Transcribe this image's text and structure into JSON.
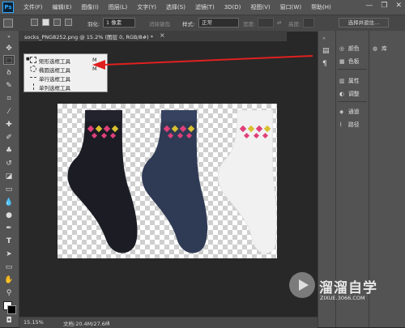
{
  "app": {
    "logo": "Ps"
  },
  "menubar": {
    "items": [
      "文件(F)",
      "编辑(E)",
      "图像(I)",
      "图层(L)",
      "文字(Y)",
      "选择(S)",
      "滤镜(T)",
      "3D(D)",
      "视图(V)",
      "窗口(W)",
      "帮助(H)"
    ],
    "window_controls": [
      "—",
      "❐",
      "✕"
    ]
  },
  "options_bar": {
    "feather_label": "羽化:",
    "feather_value": "1 像素",
    "antialias_label": "消除锯齿",
    "style_label": "样式:",
    "style_value": "正常",
    "width_label": "宽度:",
    "height_label": "高度:",
    "select_mask_label": "选择并遮住..."
  },
  "document_tab": {
    "title": "socks_PNG8252.png @ 15.2% (图层 0, RGB/8#) *",
    "close": "×"
  },
  "tool_flyout": {
    "items": [
      {
        "label": "矩形选框工具",
        "shortcut": "M",
        "icon": "rect-marquee-icon",
        "selected": true
      },
      {
        "label": "椭圆选框工具",
        "shortcut": "M",
        "icon": "ellipse-marquee-icon",
        "selected": false
      },
      {
        "label": "单行选框工具",
        "shortcut": "",
        "icon": "single-row-marquee-icon",
        "selected": false
      },
      {
        "label": "单列选框工具",
        "shortcut": "",
        "icon": "single-column-marquee-icon",
        "selected": false
      }
    ]
  },
  "panels": {
    "group1": [
      {
        "label": "颜色",
        "icon": "color-icon"
      },
      {
        "label": "色板",
        "icon": "swatches-icon"
      }
    ],
    "group2": [
      {
        "label": "属性",
        "icon": "properties-icon"
      },
      {
        "label": "调整",
        "icon": "adjustments-icon"
      }
    ],
    "group3": [
      {
        "label": "通道",
        "icon": "channels-icon"
      },
      {
        "label": "路径",
        "icon": "paths-icon"
      }
    ],
    "library": {
      "label": "库",
      "icon": "libraries-icon"
    }
  },
  "status_bar": {
    "zoom": "15.15%",
    "doc_info": "文档:20.4M/27.6M",
    "arrow": "›"
  },
  "watermark": {
    "title": "溜溜自学",
    "url": "ZIXUE.3066.COM"
  },
  "colors": {
    "sock_black": "#1b1c24",
    "sock_navy": "#2f3a55",
    "sock_white": "#f1f1f1",
    "arrow_red": "#e02020",
    "pattern_pink": "#e0407a",
    "pattern_yellow": "#d8c030"
  }
}
